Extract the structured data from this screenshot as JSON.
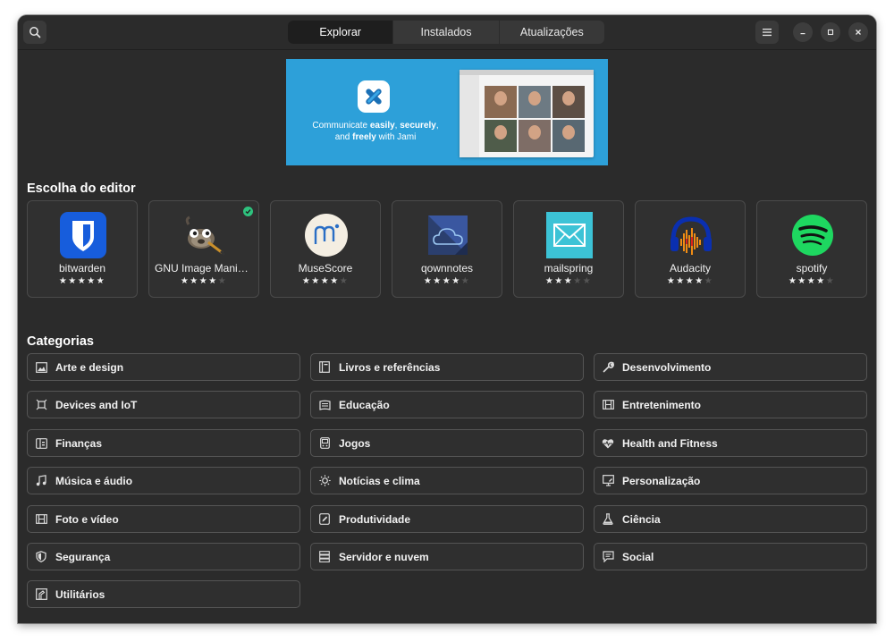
{
  "header": {
    "search_icon": "search-icon",
    "tabs": [
      {
        "label": "Explorar",
        "active": true
      },
      {
        "label": "Instalados",
        "active": false
      },
      {
        "label": "Atualizações",
        "active": false
      }
    ],
    "menu_icon": "hamburger-menu-icon",
    "window_controls": [
      "minimize-icon",
      "maximize-icon",
      "close-icon"
    ]
  },
  "banner": {
    "text_pre": "Communicate ",
    "text_easily": "easily",
    "text_sep1": ", ",
    "text_securely": "securely",
    "text_sep2": ",",
    "text_and": "and ",
    "text_freely": "freely",
    "text_post": " with Jami",
    "background": "#2da0d9"
  },
  "editors_choice": {
    "title": "Escolha do editor",
    "apps": [
      {
        "name": "bitwarden",
        "rating": 5,
        "icon": "bitwarden-icon",
        "installed": false
      },
      {
        "name": "GNU Image Manipulation Program",
        "rating": 4,
        "icon": "gimp-icon",
        "installed": true
      },
      {
        "name": "MuseScore",
        "rating": 4,
        "icon": "musescore-icon",
        "installed": false
      },
      {
        "name": "qownnotes",
        "rating": 4,
        "icon": "qownnotes-icon",
        "installed": false
      },
      {
        "name": "mailspring",
        "rating": 3,
        "icon": "mailspring-icon",
        "installed": false
      },
      {
        "name": "Audacity",
        "rating": 4,
        "icon": "audacity-icon",
        "installed": false
      },
      {
        "name": "spotify",
        "rating": 4,
        "icon": "spotify-icon",
        "installed": false
      }
    ]
  },
  "categories": {
    "title": "Categorias",
    "items": [
      {
        "label": "Arte e design",
        "icon": "image-icon"
      },
      {
        "label": "Livros e referências",
        "icon": "book-icon"
      },
      {
        "label": "Desenvolvimento",
        "icon": "wrench-icon"
      },
      {
        "label": "Devices and IoT",
        "icon": "chip-icon"
      },
      {
        "label": "Educação",
        "icon": "education-icon"
      },
      {
        "label": "Entretenimento",
        "icon": "film-icon"
      },
      {
        "label": "Finanças",
        "icon": "wallet-icon"
      },
      {
        "label": "Jogos",
        "icon": "gamepad-icon"
      },
      {
        "label": "Health and Fitness",
        "icon": "heart-pulse-icon"
      },
      {
        "label": "Música e áudio",
        "icon": "music-note-icon"
      },
      {
        "label": "Notícias e clima",
        "icon": "sun-icon"
      },
      {
        "label": "Personalização",
        "icon": "desktop-icon"
      },
      {
        "label": "Foto e vídeo",
        "icon": "film-strip-icon"
      },
      {
        "label": "Produtividade",
        "icon": "edit-icon"
      },
      {
        "label": "Ciência",
        "icon": "flask-icon"
      },
      {
        "label": "Segurança",
        "icon": "shield-icon"
      },
      {
        "label": "Servidor e nuvem",
        "icon": "server-icon"
      },
      {
        "label": "Social",
        "icon": "chat-icon"
      },
      {
        "label": "Utilitários",
        "icon": "utilities-icon"
      }
    ]
  },
  "colors": {
    "window_bg": "#2b2b2b",
    "card_bg": "#303030",
    "accent_green": "#2ec27e"
  }
}
